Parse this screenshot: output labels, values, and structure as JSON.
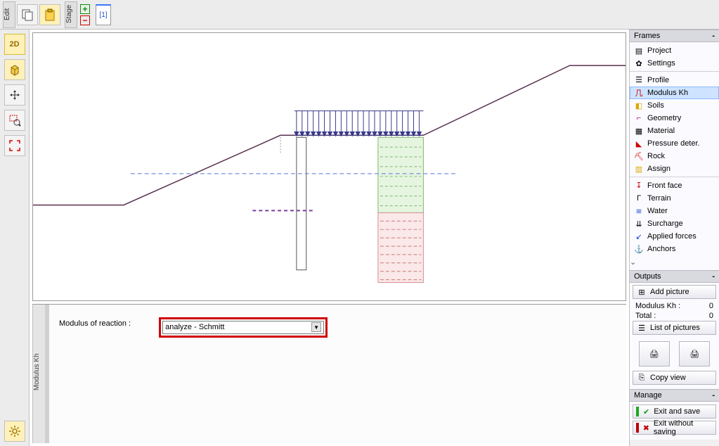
{
  "topbar": {
    "edit_label": "Edit",
    "stage_label": "Stage",
    "stage_no": "[1]"
  },
  "tools": {
    "td2": "2D",
    "td3": "3D"
  },
  "bottom": {
    "tab_label": "Modulus Kh",
    "field_label": "Modulus of reaction :",
    "dropdown_value": "analyze - Schmitt"
  },
  "frames": {
    "title": "Frames",
    "items": [
      "Project",
      "Settings",
      "Profile",
      "Modulus Kh",
      "Soils",
      "Geometry",
      "Material",
      "Pressure deter.",
      "Rock",
      "Assign",
      "Front face",
      "Terrain",
      "Water",
      "Surcharge",
      "Applied forces",
      "Anchors"
    ]
  },
  "outputs": {
    "title": "Outputs",
    "add_picture": "Add picture",
    "stat1_label": "Modulus Kh :",
    "stat1_value": "0",
    "stat2_label": "Total :",
    "stat2_value": "0",
    "list_pictures": "List of pictures",
    "copy_view": "Copy view"
  },
  "manage": {
    "title": "Manage",
    "exit_save": "Exit and save",
    "exit_nosave": "Exit without saving"
  }
}
